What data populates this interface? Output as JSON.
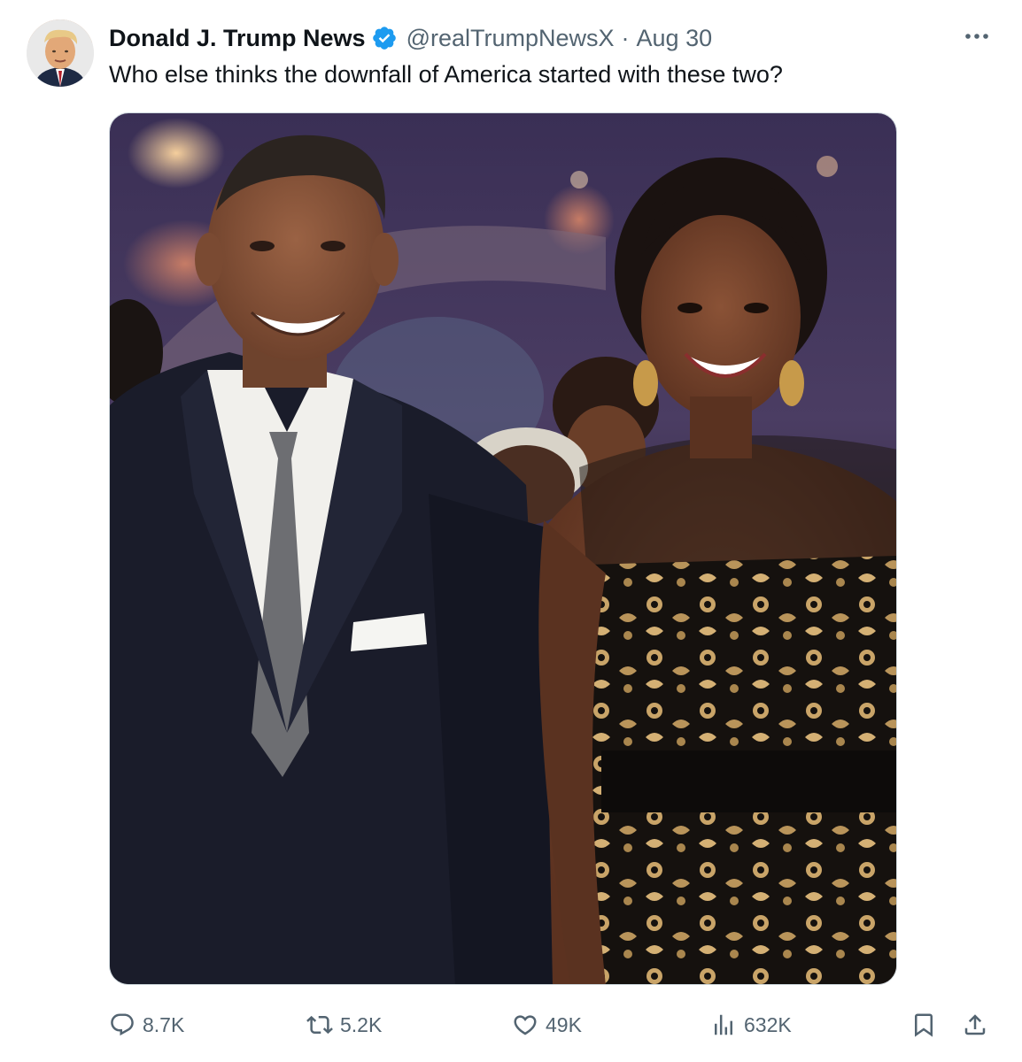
{
  "post": {
    "author_name": "Donald J. Trump News",
    "handle": "@realTrumpNewsX",
    "separator": "·",
    "date": "Aug 30",
    "text": "Who else thinks the downfall of America started with these two?",
    "more_icon": "more-horizontal-icon",
    "verified_icon": "verified-badge-icon",
    "verified_color": "#1d9bf0"
  },
  "media": {
    "description_icon": "photo"
  },
  "actions": {
    "replies": "8.7K",
    "reposts": "5.2K",
    "likes": "49K",
    "views": "632K",
    "bookmark_icon": "bookmark-icon",
    "share_icon": "share-icon"
  },
  "colors": {
    "text_primary": "#0f1419",
    "text_secondary": "#536471",
    "border": "#cfd9de",
    "accent": "#1d9bf0"
  }
}
